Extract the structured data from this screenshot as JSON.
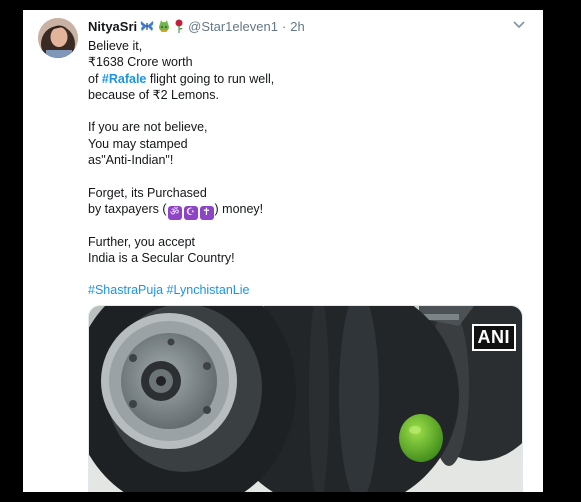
{
  "tweet": {
    "author_name": "NityaSri",
    "author_emojis": [
      "butterfly-icon",
      "cat-icon",
      "rose-icon"
    ],
    "handle": "@Star1eleven1",
    "separator": "·",
    "time": "2h",
    "lines": {
      "l1": "Believe it,",
      "l2": "₹1638 Crore worth",
      "l3_prefix": "of ",
      "l3_hashtag": "#Rafale",
      "l3_suffix": " flight going to run well,",
      "l4": "because of ₹2 Lemons.",
      "l5": "If you are not believe,",
      "l6": "You may stamped",
      "l7": "as\"Anti-Indian\"!",
      "l8": "Forget, its Purchased",
      "l9_prefix": "by taxpayers (",
      "l9_suffix": ") money!",
      "l10": "Further, you accept",
      "l11": "India is a Secular Country!"
    },
    "religious_symbols": [
      "ॐ",
      "☪",
      "✝"
    ],
    "hashtags": [
      "#ShastraPuja",
      "#LynchistanLie"
    ],
    "media": {
      "watermark": "ANI"
    }
  },
  "colors": {
    "background": "#000000",
    "card": "#ffffff",
    "text": "#14171a",
    "muted": "#657786",
    "link": "#1b95e0",
    "symbol_bg": "#8e44c7"
  }
}
